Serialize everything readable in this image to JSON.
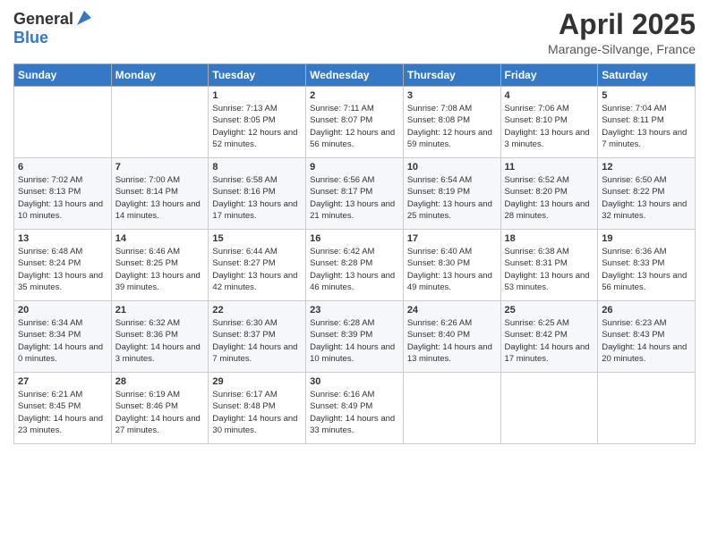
{
  "header": {
    "logo_line1": "General",
    "logo_line2": "Blue",
    "month_title": "April 2025",
    "location": "Marange-Silvange, France"
  },
  "days_of_week": [
    "Sunday",
    "Monday",
    "Tuesday",
    "Wednesday",
    "Thursday",
    "Friday",
    "Saturday"
  ],
  "weeks": [
    [
      {
        "day": "",
        "info": ""
      },
      {
        "day": "",
        "info": ""
      },
      {
        "day": "1",
        "info": "Sunrise: 7:13 AM\nSunset: 8:05 PM\nDaylight: 12 hours and 52 minutes."
      },
      {
        "day": "2",
        "info": "Sunrise: 7:11 AM\nSunset: 8:07 PM\nDaylight: 12 hours and 56 minutes."
      },
      {
        "day": "3",
        "info": "Sunrise: 7:08 AM\nSunset: 8:08 PM\nDaylight: 12 hours and 59 minutes."
      },
      {
        "day": "4",
        "info": "Sunrise: 7:06 AM\nSunset: 8:10 PM\nDaylight: 13 hours and 3 minutes."
      },
      {
        "day": "5",
        "info": "Sunrise: 7:04 AM\nSunset: 8:11 PM\nDaylight: 13 hours and 7 minutes."
      }
    ],
    [
      {
        "day": "6",
        "info": "Sunrise: 7:02 AM\nSunset: 8:13 PM\nDaylight: 13 hours and 10 minutes."
      },
      {
        "day": "7",
        "info": "Sunrise: 7:00 AM\nSunset: 8:14 PM\nDaylight: 13 hours and 14 minutes."
      },
      {
        "day": "8",
        "info": "Sunrise: 6:58 AM\nSunset: 8:16 PM\nDaylight: 13 hours and 17 minutes."
      },
      {
        "day": "9",
        "info": "Sunrise: 6:56 AM\nSunset: 8:17 PM\nDaylight: 13 hours and 21 minutes."
      },
      {
        "day": "10",
        "info": "Sunrise: 6:54 AM\nSunset: 8:19 PM\nDaylight: 13 hours and 25 minutes."
      },
      {
        "day": "11",
        "info": "Sunrise: 6:52 AM\nSunset: 8:20 PM\nDaylight: 13 hours and 28 minutes."
      },
      {
        "day": "12",
        "info": "Sunrise: 6:50 AM\nSunset: 8:22 PM\nDaylight: 13 hours and 32 minutes."
      }
    ],
    [
      {
        "day": "13",
        "info": "Sunrise: 6:48 AM\nSunset: 8:24 PM\nDaylight: 13 hours and 35 minutes."
      },
      {
        "day": "14",
        "info": "Sunrise: 6:46 AM\nSunset: 8:25 PM\nDaylight: 13 hours and 39 minutes."
      },
      {
        "day": "15",
        "info": "Sunrise: 6:44 AM\nSunset: 8:27 PM\nDaylight: 13 hours and 42 minutes."
      },
      {
        "day": "16",
        "info": "Sunrise: 6:42 AM\nSunset: 8:28 PM\nDaylight: 13 hours and 46 minutes."
      },
      {
        "day": "17",
        "info": "Sunrise: 6:40 AM\nSunset: 8:30 PM\nDaylight: 13 hours and 49 minutes."
      },
      {
        "day": "18",
        "info": "Sunrise: 6:38 AM\nSunset: 8:31 PM\nDaylight: 13 hours and 53 minutes."
      },
      {
        "day": "19",
        "info": "Sunrise: 6:36 AM\nSunset: 8:33 PM\nDaylight: 13 hours and 56 minutes."
      }
    ],
    [
      {
        "day": "20",
        "info": "Sunrise: 6:34 AM\nSunset: 8:34 PM\nDaylight: 14 hours and 0 minutes."
      },
      {
        "day": "21",
        "info": "Sunrise: 6:32 AM\nSunset: 8:36 PM\nDaylight: 14 hours and 3 minutes."
      },
      {
        "day": "22",
        "info": "Sunrise: 6:30 AM\nSunset: 8:37 PM\nDaylight: 14 hours and 7 minutes."
      },
      {
        "day": "23",
        "info": "Sunrise: 6:28 AM\nSunset: 8:39 PM\nDaylight: 14 hours and 10 minutes."
      },
      {
        "day": "24",
        "info": "Sunrise: 6:26 AM\nSunset: 8:40 PM\nDaylight: 14 hours and 13 minutes."
      },
      {
        "day": "25",
        "info": "Sunrise: 6:25 AM\nSunset: 8:42 PM\nDaylight: 14 hours and 17 minutes."
      },
      {
        "day": "26",
        "info": "Sunrise: 6:23 AM\nSunset: 8:43 PM\nDaylight: 14 hours and 20 minutes."
      }
    ],
    [
      {
        "day": "27",
        "info": "Sunrise: 6:21 AM\nSunset: 8:45 PM\nDaylight: 14 hours and 23 minutes."
      },
      {
        "day": "28",
        "info": "Sunrise: 6:19 AM\nSunset: 8:46 PM\nDaylight: 14 hours and 27 minutes."
      },
      {
        "day": "29",
        "info": "Sunrise: 6:17 AM\nSunset: 8:48 PM\nDaylight: 14 hours and 30 minutes."
      },
      {
        "day": "30",
        "info": "Sunrise: 6:16 AM\nSunset: 8:49 PM\nDaylight: 14 hours and 33 minutes."
      },
      {
        "day": "",
        "info": ""
      },
      {
        "day": "",
        "info": ""
      },
      {
        "day": "",
        "info": ""
      }
    ]
  ]
}
